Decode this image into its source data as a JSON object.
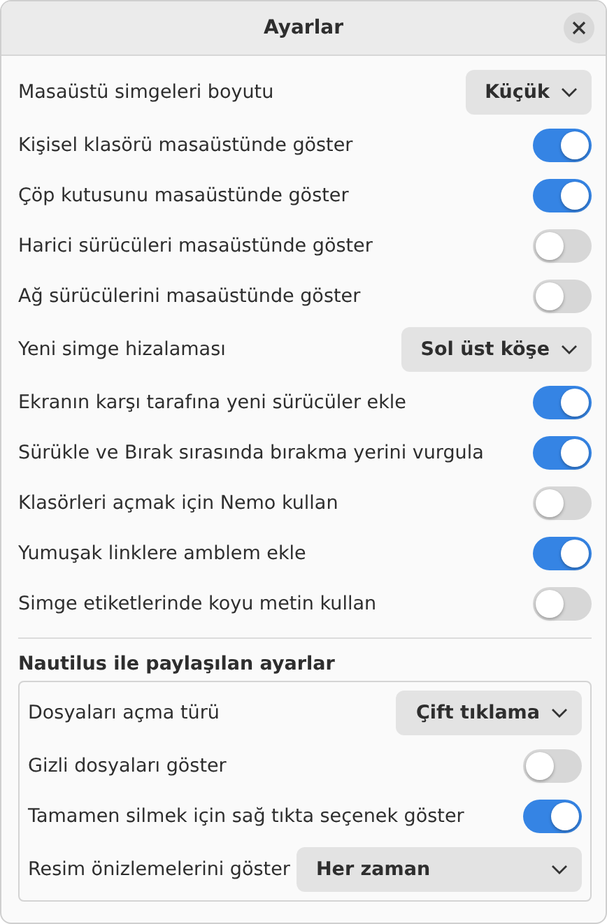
{
  "window": {
    "title": "Ayarlar"
  },
  "rows": [
    {
      "kind": "dropdown",
      "label": "Masaüstü simgeleri boyutu",
      "value": "Küçük"
    },
    {
      "kind": "switch",
      "label": "Kişisel klasörü masaüstünde göster",
      "on": true
    },
    {
      "kind": "switch",
      "label": "Çöp kutusunu masaüstünde göster",
      "on": true
    },
    {
      "kind": "switch",
      "label": "Harici sürücüleri masaüstünde göster",
      "on": false
    },
    {
      "kind": "switch",
      "label": "Ağ sürücülerini masaüstünde göster",
      "on": false
    },
    {
      "kind": "dropdown",
      "label": "Yeni simge hizalaması",
      "value": "Sol üst köşe"
    },
    {
      "kind": "switch",
      "label": "Ekranın karşı tarafına yeni sürücüler ekle",
      "on": true
    },
    {
      "kind": "switch",
      "label": "Sürükle ve Bırak sırasında bırakma yerini vurgula",
      "on": true
    },
    {
      "kind": "switch",
      "label": "Klasörleri açmak için Nemo kullan",
      "on": false
    },
    {
      "kind": "switch",
      "label": "Yumuşak linklere amblem ekle",
      "on": true
    },
    {
      "kind": "switch",
      "label": "Simge etiketlerinde koyu metin kullan",
      "on": false
    }
  ],
  "section": {
    "title": "Nautilus ile paylaşılan ayarlar",
    "rows": [
      {
        "kind": "dropdown",
        "label": "Dosyaları açma türü",
        "value": "Çift tıklama"
      },
      {
        "kind": "switch",
        "label": "Gizli dosyaları göster",
        "on": false
      },
      {
        "kind": "switch",
        "label": "Tamamen silmek için sağ tıkta seçenek göster",
        "on": true
      },
      {
        "kind": "dropdown",
        "label": "Resim önizlemelerini göster",
        "value": "Her zaman",
        "wide": true
      }
    ]
  }
}
